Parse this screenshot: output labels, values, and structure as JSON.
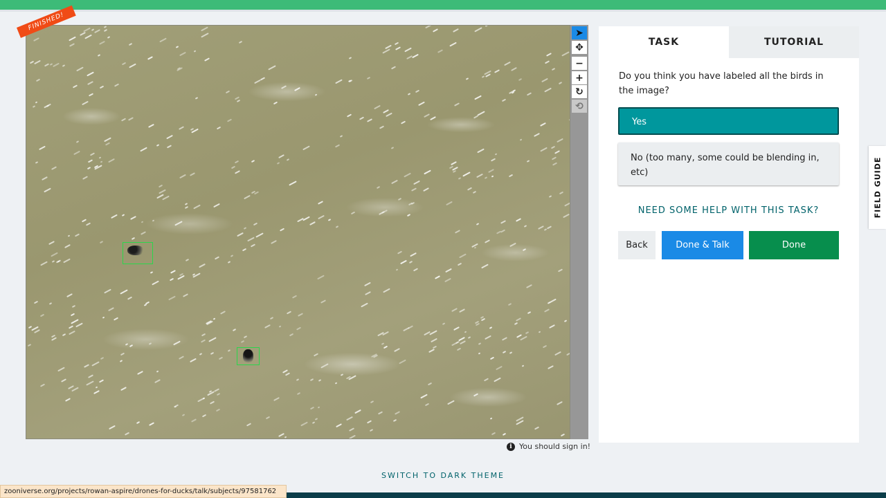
{
  "viewer": {
    "ribbon": "FINISHED!",
    "signin_message": "You should sign in!"
  },
  "tools": [
    {
      "name": "pointer-icon",
      "glyph": "➤"
    },
    {
      "name": "pan-icon",
      "glyph": "✥"
    },
    {
      "name": "zoom-out-icon",
      "glyph": "−"
    },
    {
      "name": "zoom-in-icon",
      "glyph": "+"
    },
    {
      "name": "rotate-icon",
      "glyph": "↻"
    },
    {
      "name": "reset-icon",
      "glyph": "⟲"
    }
  ],
  "task": {
    "tabs": [
      "TASK",
      "TUTORIAL"
    ],
    "question": "Do you think you have labeled all the birds in the image?",
    "answers": [
      "Yes",
      "No (too many, some could be blending in, etc)"
    ],
    "help_link": "NEED SOME HELP WITH THIS TASK?",
    "buttons": {
      "back": "Back",
      "done_talk": "Done & Talk",
      "done": "Done"
    }
  },
  "field_guide": "FIELD GUIDE",
  "footer": {
    "dark_theme": "SWITCH TO DARK THEME",
    "status_url": "zooniverse.org/projects/rowan-aspire/drones-for-ducks/talk/subjects/97581762"
  },
  "colors": {
    "brand_green": "#3dbb78",
    "answer_selected": "#00979d",
    "done_talk": "#1a8ae6",
    "done": "#078e4d",
    "ribbon": "#f04b16"
  }
}
